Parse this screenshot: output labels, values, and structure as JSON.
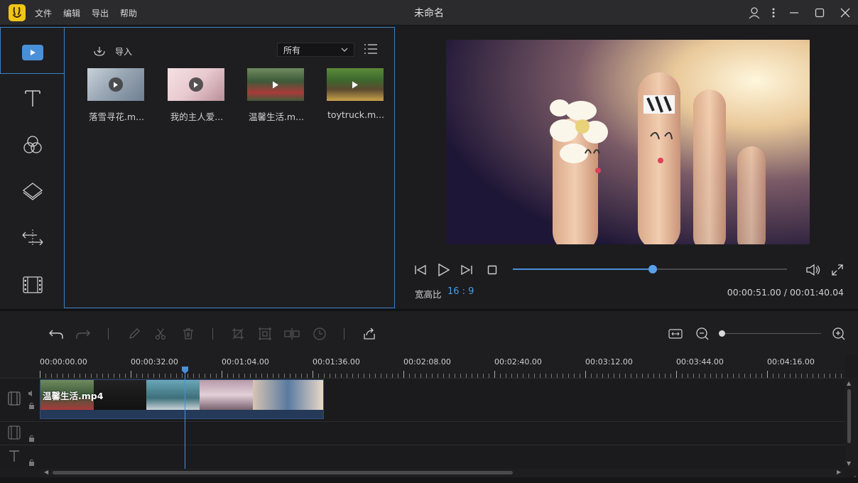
{
  "app": {
    "title": "未命名",
    "logo_icon": "rabbit-logo-icon",
    "menu": [
      "文件",
      "编辑",
      "导出",
      "帮助"
    ]
  },
  "sidebar": {
    "items": [
      {
        "name": "media",
        "icon": "media-play-icon",
        "active": true
      },
      {
        "name": "text",
        "icon": "text-icon"
      },
      {
        "name": "filters",
        "icon": "filter-circles-icon"
      },
      {
        "name": "overlays",
        "icon": "layers-icon"
      },
      {
        "name": "transitions",
        "icon": "transition-arrows-icon"
      },
      {
        "name": "elements",
        "icon": "film-strip-icon"
      }
    ]
  },
  "library": {
    "import_label": "导入",
    "filter_value": "所有",
    "items": [
      {
        "name": "落雪寻花.m...",
        "palette": [
          "#9aa7b4",
          "#c9d2da",
          "#6f7f92"
        ]
      },
      {
        "name": "我的主人爱...",
        "palette": [
          "#e8c9d0",
          "#f3e1e4",
          "#b98e98"
        ]
      },
      {
        "name": "温馨生活.m...",
        "palette": [
          "#3d5b3a",
          "#a93a3a",
          "#6f8a5e"
        ]
      },
      {
        "name": "toytruck.m...",
        "palette": [
          "#3d6a2e",
          "#c9a24a",
          "#5c4a30"
        ]
      }
    ]
  },
  "preview": {
    "aspect_label": "宽高比",
    "aspect_value": "16 : 9",
    "current_time": "00:00:51.00",
    "total_time": "00:01:40.04",
    "time_separator": " / ",
    "progress": 0.51
  },
  "timeline": {
    "ruler_labels": [
      "00:00:00.00",
      "00:00:32.00",
      "00:01:04.00",
      "00:01:36.00",
      "00:02:08.00",
      "00:02:40.00",
      "00:03:12.00",
      "00:03:44.00",
      "00:04:16.00"
    ],
    "clip_name": "温馨生活.mp4"
  },
  "colors": {
    "accent": "#4a90d9",
    "panel": "#1e1e20",
    "logo": "#f0c514"
  }
}
